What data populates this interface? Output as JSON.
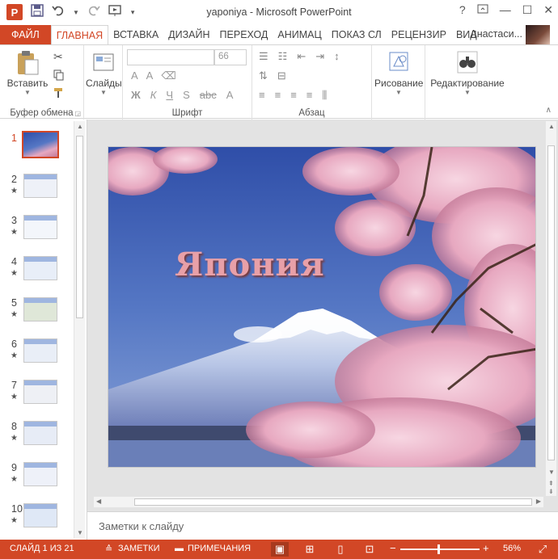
{
  "window": {
    "title": "yaponiya - Microsoft PowerPoint",
    "help_label": "?",
    "minimize_label": "—",
    "maximize_label": "☐",
    "close_label": "✕"
  },
  "qat": {
    "app_icon_letter": "P",
    "save_icon": "save-icon",
    "undo_icon": "undo-icon",
    "redo_icon": "redo-icon",
    "start_presentation_icon": "slideshow-icon",
    "customize_icon": "customize-icon"
  },
  "tabs": [
    {
      "label": "ФАЙЛ",
      "kind": "file"
    },
    {
      "label": "ГЛАВНАЯ",
      "kind": "active"
    },
    {
      "label": "ВСТАВКА",
      "kind": ""
    },
    {
      "label": "ДИЗАЙН",
      "kind": ""
    },
    {
      "label": "ПЕРЕХОД",
      "kind": ""
    },
    {
      "label": "АНИМАЦ",
      "kind": ""
    },
    {
      "label": "ПОКАЗ СЛ",
      "kind": ""
    },
    {
      "label": "РЕЦЕНЗИР",
      "kind": ""
    },
    {
      "label": "ВИД",
      "kind": ""
    }
  ],
  "user": {
    "name": "Анастаси..."
  },
  "ribbon": {
    "clipboard": {
      "label": "Буфер обмена",
      "paste_label": "Вставить"
    },
    "slides": {
      "label": "Слайды"
    },
    "font": {
      "label": "Шрифт",
      "font_name": "",
      "font_size": "66"
    },
    "paragraph": {
      "label": "Абзац"
    },
    "drawing": {
      "label": "Рисование"
    },
    "editing": {
      "label": "Редактирование"
    }
  },
  "thumbnails": [
    {
      "number": "1",
      "star": "",
      "active": true
    },
    {
      "number": "2",
      "star": "★",
      "active": false
    },
    {
      "number": "3",
      "star": "★",
      "active": false
    },
    {
      "number": "4",
      "star": "★",
      "active": false
    },
    {
      "number": "5",
      "star": "★",
      "active": false
    },
    {
      "number": "6",
      "star": "★",
      "active": false
    },
    {
      "number": "7",
      "star": "★",
      "active": false
    },
    {
      "number": "8",
      "star": "★",
      "active": false
    },
    {
      "number": "9",
      "star": "★",
      "active": false
    },
    {
      "number": "10",
      "star": "★",
      "active": false
    }
  ],
  "slide": {
    "title": "Япония"
  },
  "notes": {
    "placeholder": "Заметки к слайду"
  },
  "status": {
    "slide_info": "СЛАЙД 1 ИЗ 21",
    "notes_label": "ЗАМЕТКИ",
    "comments_label": "ПРИМЕЧАНИЯ",
    "zoom_minus": "−",
    "zoom_plus": "+",
    "zoom_level": "56%",
    "zoom_fraction": 0.56
  },
  "colors": {
    "accent": "#d24726",
    "title_text": "#e8a0a8"
  }
}
